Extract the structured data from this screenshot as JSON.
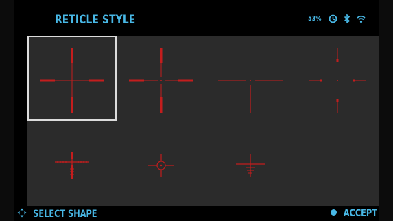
{
  "header": {
    "title": "RETICLE STYLE",
    "battery": "53%",
    "status_icons": [
      "timer-icon",
      "bluetooth-icon",
      "wifi-icon"
    ]
  },
  "reticles": [
    {
      "id": "reticle-1",
      "selected": true
    },
    {
      "id": "reticle-2",
      "selected": false
    },
    {
      "id": "reticle-3",
      "selected": false
    },
    {
      "id": "reticle-4",
      "selected": false
    },
    {
      "id": "reticle-5",
      "selected": false
    },
    {
      "id": "reticle-6",
      "selected": false
    },
    {
      "id": "reticle-7",
      "selected": false
    }
  ],
  "footer": {
    "select_label": "SELECT SHAPE",
    "accept_label": "ACCEPT"
  },
  "colors": {
    "accent": "#48b8e6",
    "reticle": "#c41d1d",
    "panel": "#2b2b2b",
    "selection": "#dcdcdc"
  }
}
